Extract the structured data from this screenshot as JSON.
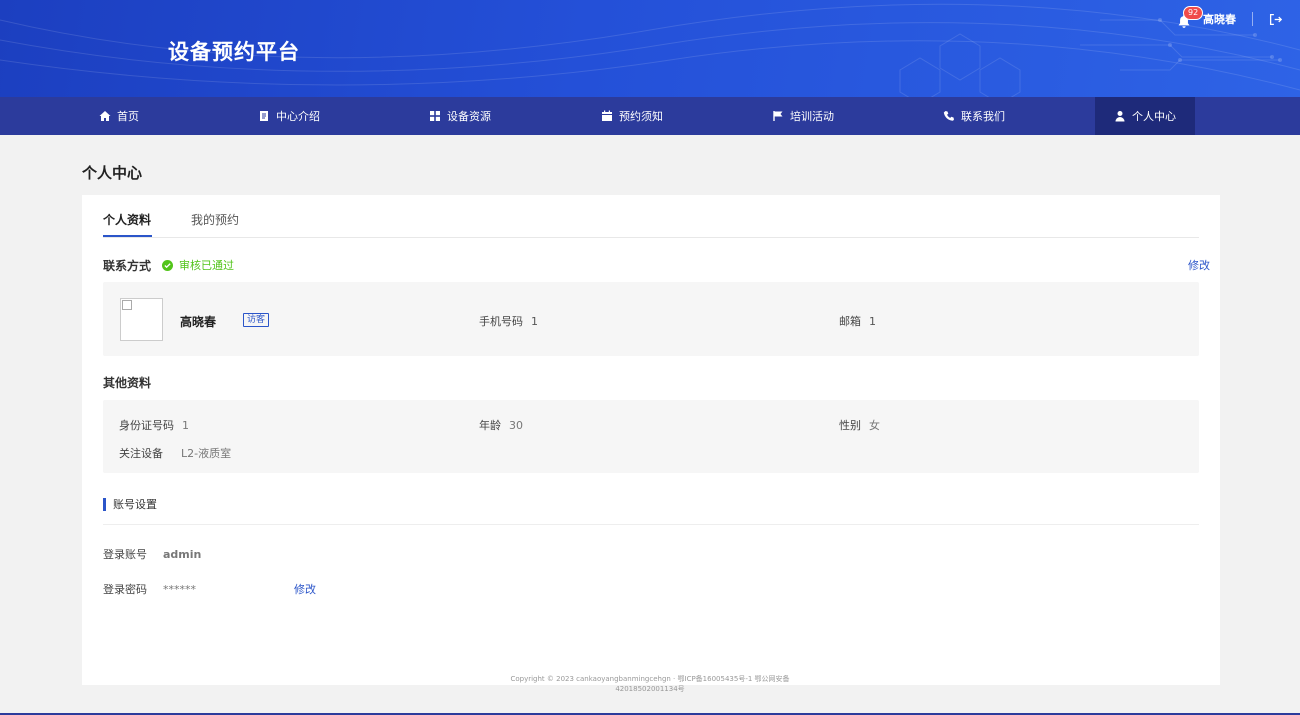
{
  "header": {
    "site_title": "设备预约平台",
    "notification_count": "92",
    "user_name": "高晓春"
  },
  "nav": {
    "items": [
      {
        "label": "首页",
        "icon": "home-icon"
      },
      {
        "label": "中心介绍",
        "icon": "document-icon"
      },
      {
        "label": "设备资源",
        "icon": "grid-icon"
      },
      {
        "label": "预约须知",
        "icon": "calendar-icon"
      },
      {
        "label": "培训活动",
        "icon": "flag-icon"
      },
      {
        "label": "联系我们",
        "icon": "phone-icon"
      },
      {
        "label": "个人中心",
        "icon": "user-icon",
        "active": true
      }
    ]
  },
  "page": {
    "title": "个人中心",
    "tabs": [
      {
        "label": "个人资料",
        "active": true
      },
      {
        "label": "我的预约",
        "active": false
      }
    ]
  },
  "contact": {
    "heading": "联系方式",
    "status": "审核已通过",
    "edit_label": "修改",
    "name": "高晓春",
    "role_tag": "访客",
    "phone_label": "手机号码",
    "phone_value": "1",
    "email_label": "邮箱",
    "email_value": "1"
  },
  "other": {
    "heading": "其他资料",
    "id_label": "身份证号码",
    "id_value": "1",
    "age_label": "年龄",
    "age_value": "30",
    "gender_label": "性别",
    "gender_value": "女",
    "device_label": "关注设备",
    "device_value": "L2-液质室"
  },
  "account": {
    "heading": "账号设置",
    "login_label": "登录账号",
    "login_value": "admin",
    "password_label": "登录密码",
    "password_value": "******",
    "edit_label": "修改"
  },
  "footer": {
    "line1": "Copyright © 2023 cankaoyangbanmingcehgn · 鄂ICP备16005435号-1 鄂公网安备",
    "line2": "42018502001134号"
  },
  "colors": {
    "banner": "#2450d8",
    "nav": "#2c3b9c",
    "nav_active": "#1e2a7a",
    "accent": "#2b55c9",
    "success": "#52c41a",
    "badge": "#f04b4b"
  }
}
